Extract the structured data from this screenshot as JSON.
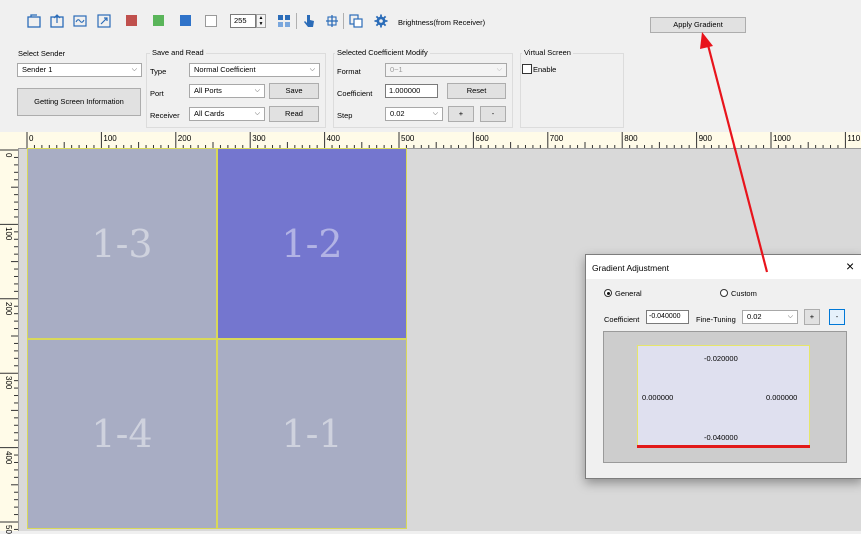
{
  "toolbar": {
    "brightness_value": "255",
    "brightness_label": "Brightness(from Receiver)",
    "apply_gradient": "Apply Gradient",
    "colors": {
      "red": "#c0504d",
      "green": "#5ab55a",
      "blue": "#2f73c9"
    }
  },
  "select_sender": {
    "title": "Select Sender",
    "sender_value": "Sender 1",
    "get_info": "Getting Screen Information"
  },
  "save_read": {
    "title": "Save and Read",
    "type_label": "Type",
    "type_value": "Normal Coefficient",
    "port_label": "Port",
    "port_value": "All Ports",
    "receiver_label": "Receiver",
    "receiver_value": "All Cards",
    "save": "Save",
    "read": "Read"
  },
  "coef_modify": {
    "title": "Selected Coefficient Modify",
    "format_label": "Format",
    "format_value": "0~1",
    "coef_label": "Coefficient",
    "coef_value": "1.000000",
    "reset": "Reset",
    "step_label": "Step",
    "step_value": "0.02",
    "plus": "+",
    "minus": "-"
  },
  "virtual_screen": {
    "title": "Virtual Screen",
    "enable": "Enable"
  },
  "ruler": {
    "h_labels": [
      "0",
      "100",
      "200",
      "300",
      "400",
      "500",
      "600",
      "700",
      "800",
      "900",
      "1000",
      "110"
    ],
    "v_labels": [
      "0",
      "100",
      "200",
      "300",
      "400",
      "50"
    ]
  },
  "screens": [
    {
      "label": "1-3",
      "color": "#a8adc4"
    },
    {
      "label": "1-2",
      "color": "#7476cf"
    },
    {
      "label": "1-4",
      "color": "#a8adc4"
    },
    {
      "label": "1-1",
      "color": "#a8adc4"
    }
  ],
  "dialog": {
    "title": "Gradient Adjustment",
    "close": "×",
    "general": "General",
    "custom": "Custom",
    "coef_label": "Coefficient",
    "coef_value": "-0.040000",
    "fine_label": "Fine-Tuning",
    "fine_value": "0.02",
    "plus": "+",
    "minus": "-",
    "top_value": "-0.020000",
    "left_value": "0.000000",
    "right_value": "0.000000",
    "bottom_value": "-0.040000"
  },
  "annotation": {
    "arrow_color": "#e8141c"
  }
}
